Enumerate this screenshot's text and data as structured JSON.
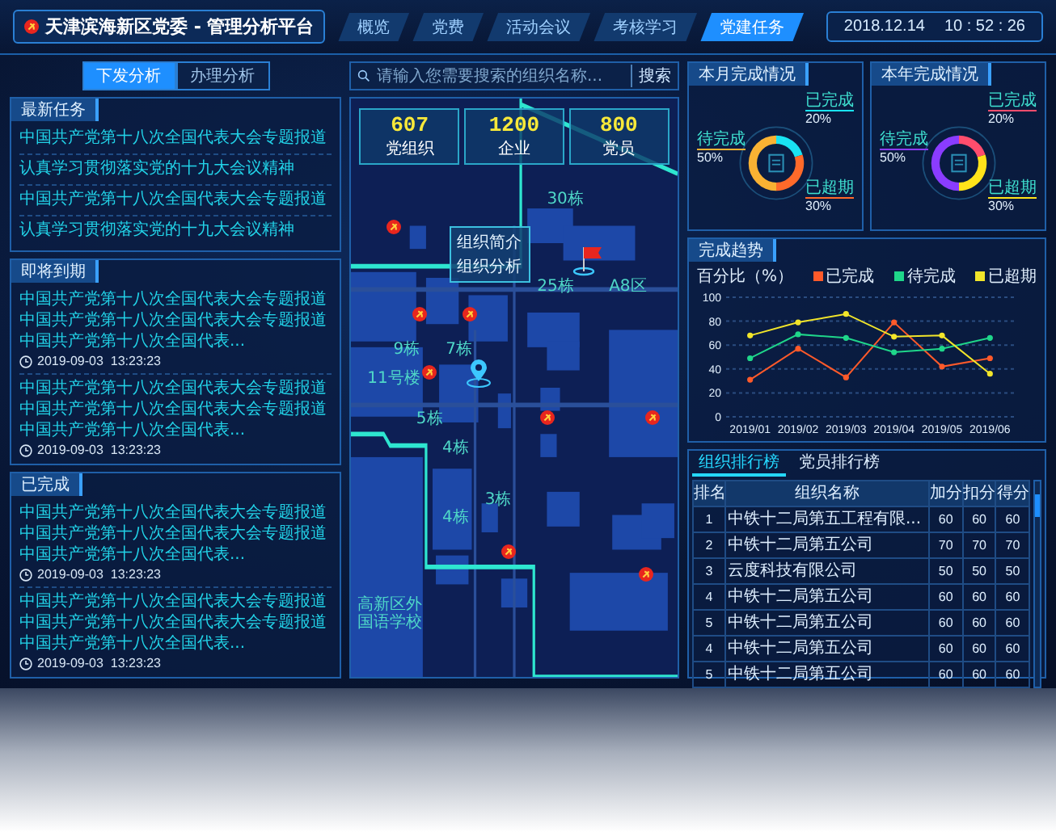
{
  "header": {
    "title": "天津滨海新区党委 - 管理分析平台",
    "nav": [
      {
        "label": "概览",
        "selected": false
      },
      {
        "label": "党费",
        "selected": false
      },
      {
        "label": "活动会议",
        "selected": false
      },
      {
        "label": "考核学习",
        "selected": false
      },
      {
        "label": "党建任务",
        "selected": true
      }
    ],
    "date": "2018.12.14",
    "time": "10 : 52 : 26"
  },
  "left": {
    "toggle": [
      {
        "label": "下发分析",
        "selected": true
      },
      {
        "label": "办理分析",
        "selected": false
      }
    ],
    "sections": [
      {
        "title": "最新任务",
        "items": [
          {
            "text": "中国共产党第十八次全国代表大会专题报道"
          },
          {
            "text": "认真学习贯彻落实党的十九大会议精神"
          },
          {
            "text": "中国共产党第十八次全国代表大会专题报道"
          },
          {
            "text": "认真学习贯彻落实党的十九大会议精神"
          }
        ]
      },
      {
        "title": "即将到期",
        "items": [
          {
            "text": "中国共产党第十八次全国代表大会专题报道中国共产党第十八次全国代表大会专题报道中国共产党第十八次全国代表...",
            "time": "2019-09-03  13:23:23"
          },
          {
            "text": "中国共产党第十八次全国代表大会专题报道中国共产党第十八次全国代表大会专题报道中国共产党第十八次全国代表...",
            "time": "2019-09-03  13:23:23"
          }
        ]
      },
      {
        "title": "已完成",
        "items": [
          {
            "text": "中国共产党第十八次全国代表大会专题报道中国共产党第十八次全国代表大会专题报道中国共产党第十八次全国代表...",
            "time": "2019-09-03  13:23:23"
          },
          {
            "text": "中国共产党第十八次全国代表大会专题报道中国共产党第十八次全国代表大会专题报道中国共产党第十八次全国代表...",
            "time": "2019-09-03  13:23:23"
          }
        ]
      }
    ]
  },
  "map": {
    "search": {
      "placeholder": "请输入您需要搜索的组织名称...",
      "button": "搜索"
    },
    "stats": [
      {
        "value": "607",
        "label": "党组织"
      },
      {
        "value": "1200",
        "label": "企业"
      },
      {
        "value": "800",
        "label": "党员"
      }
    ],
    "popup": [
      "组织简介",
      "组织分析"
    ],
    "labels": [
      "30栋",
      "25栋",
      "A8区",
      "9栋",
      "7栋",
      "11号楼",
      "5栋",
      "4栋",
      "3栋",
      "4栋",
      "高新区外国语学校"
    ]
  },
  "right": {
    "donuts": [
      {
        "title": "本月完成情况",
        "chart_data": {
          "type": "donut",
          "categories": [
            "待完成",
            "已完成",
            "已超期"
          ],
          "values": [
            50,
            20,
            30
          ],
          "value_labels": [
            "50%",
            "20%",
            "30%"
          ],
          "colors": [
            "#f9b233",
            "#19e3f2",
            "#ff6a2a"
          ]
        }
      },
      {
        "title": "本年完成情况",
        "chart_data": {
          "type": "donut",
          "categories": [
            "待完成",
            "已完成",
            "已超期"
          ],
          "values": [
            50,
            20,
            30
          ],
          "value_labels": [
            "50%",
            "20%",
            "30%"
          ],
          "colors": [
            "#8a3cff",
            "#ff4d6d",
            "#ffe31a"
          ]
        }
      }
    ],
    "trend": {
      "title": "完成趋势",
      "chart_data": {
        "type": "line",
        "ylabel": "百分比（%）",
        "categories": [
          "2019/01",
          "2019/02",
          "2019/03",
          "2019/04",
          "2019/05",
          "2019/06"
        ],
        "ylim": [
          0,
          100
        ],
        "grid": true,
        "yticks": [
          0,
          20,
          40,
          60,
          80,
          100
        ],
        "series": [
          {
            "name": "已完成",
            "color": "#ff5a2a",
            "marker": "circle",
            "values": [
              31,
              57,
              33,
              79,
              42,
              49
            ]
          },
          {
            "name": "待完成",
            "color": "#1fd68a",
            "marker": "circle",
            "values": [
              49,
              69,
              66,
              54,
              57,
              66
            ]
          },
          {
            "name": "已超期",
            "color": "#f2e52a",
            "marker": "circle",
            "values": [
              68,
              79,
              86,
              67,
              68,
              36
            ]
          }
        ]
      }
    },
    "ranking": {
      "tabs": [
        {
          "label": "组织排行榜",
          "selected": true
        },
        {
          "label": "党员排行榜",
          "selected": false
        }
      ],
      "columns": [
        "排名",
        "组织名称",
        "加分",
        "扣分",
        "得分"
      ],
      "rows": [
        [
          "1",
          "中铁十二局第五工程有限...",
          "60",
          "60",
          "60"
        ],
        [
          "2",
          "中铁十二局第五公司",
          "70",
          "70",
          "70"
        ],
        [
          "3",
          "云度科技有限公司",
          "50",
          "50",
          "50"
        ],
        [
          "4",
          "中铁十二局第五公司",
          "60",
          "60",
          "60"
        ],
        [
          "5",
          "中铁十二局第五公司",
          "60",
          "60",
          "60"
        ],
        [
          "4",
          "中铁十二局第五公司",
          "60",
          "60",
          "60"
        ],
        [
          "5",
          "中铁十二局第五公司",
          "60",
          "60",
          "60"
        ]
      ]
    }
  }
}
